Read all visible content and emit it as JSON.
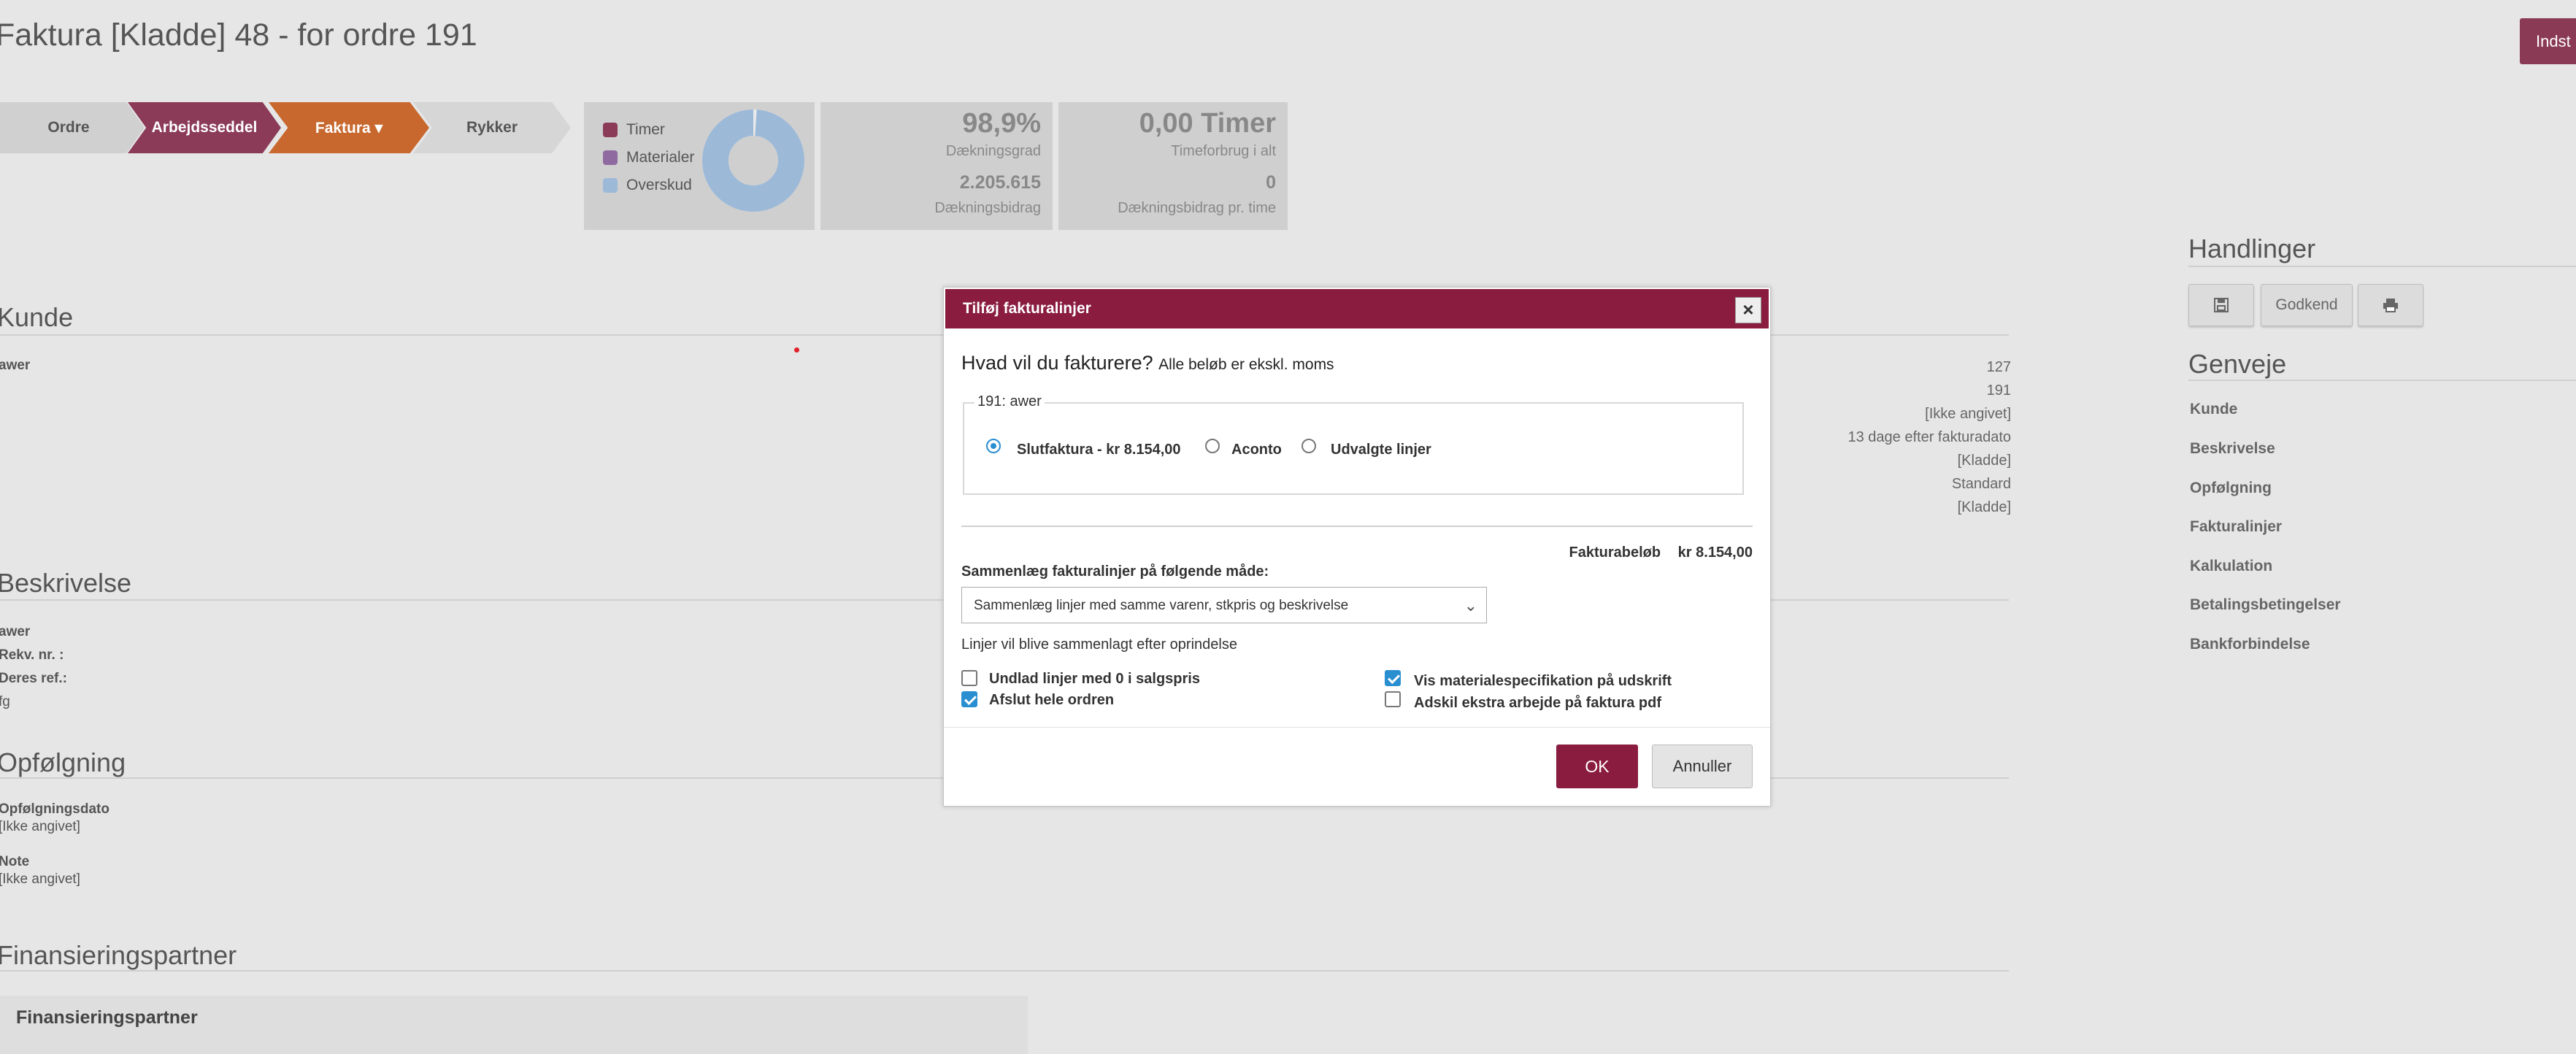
{
  "page": {
    "title": "Faktura [Kladde] 48 - for ordre 191",
    "settings_button": "Indst"
  },
  "workflow": {
    "steps": [
      "Ordre",
      "Arbejdsseddel",
      "Faktura ▾",
      "Rykker"
    ]
  },
  "legend": {
    "items": [
      {
        "label": "Timer",
        "color": "#8b3b58"
      },
      {
        "label": "Materialer",
        "color": "#8e6aa0"
      },
      {
        "label": "Overskud",
        "color": "#9cb9d8"
      }
    ]
  },
  "donut": {
    "overskud_fraction": 0.989
  },
  "kpi": {
    "coverage_pct": "98,9%",
    "coverage_label": "Dækningsgrad",
    "contribution": "2.205.615",
    "contribution_label": "Dækningsbidrag",
    "hours": "0,00 Timer",
    "hours_label": "Timeforbrug i alt",
    "per_hour": "0",
    "per_hour_label": "Dækningsbidrag pr. time"
  },
  "sections": {
    "kunde": {
      "title": "Kunde",
      "customer_name": "awer",
      "values": [
        "127",
        "191",
        "[Ikke angivet]",
        "13 dage efter fakturadato",
        "[Kladde]",
        "Standard",
        "[Kladde]"
      ]
    },
    "beskrivelse": {
      "title": "Beskrivelse",
      "lines": [
        "awer",
        "Rekv. nr. :",
        "Deres ref.:",
        "fg"
      ]
    },
    "opfolgning": {
      "title": "Opfølgning",
      "date_label": "Opfølgningsdato",
      "date_value": "[Ikke angivet]",
      "note_label": "Note",
      "note_value": "[Ikke angivet]"
    },
    "finansiering": {
      "title": "Finansieringspartner",
      "card_title": "Finansieringspartner"
    }
  },
  "sidebar": {
    "actions_title": "Handlinger",
    "approve_button": "Godkend",
    "shortcuts_title": "Genveje",
    "links": [
      "Kunde",
      "Beskrivelse",
      "Opfølgning",
      "Fakturalinjer",
      "Kalkulation",
      "Betalingsbetingelser",
      "Bankforbindelse"
    ]
  },
  "modal": {
    "title": "Tilføj fakturalinjer",
    "close": "×",
    "question": "Hvad vil du fakturere?",
    "question_note": "Alle beløb er ekskl. moms",
    "fieldset_legend": "191: awer",
    "radios": [
      {
        "label": "Slutfaktura - kr 8.154,00",
        "checked": true
      },
      {
        "label": "Aconto",
        "checked": false
      },
      {
        "label": "Udvalgte linjer",
        "checked": false
      }
    ],
    "amount_label": "Fakturabeløb",
    "amount_value": "kr 8.154,00",
    "merge_label": "Sammenlæg fakturalinjer på følgende måde:",
    "merge_selected": "Sammenlæg linjer med samme varenr, stkpris og beskrivelse",
    "merge_note": "Linjer vil blive sammenlagt efter oprindelse",
    "checkboxes": [
      {
        "label": "Undlad linjer med 0 i salgspris",
        "checked": false
      },
      {
        "label": "Afslut hele ordren",
        "checked": true
      },
      {
        "label": "Vis materialespecifikation på udskrift",
        "checked": true
      },
      {
        "label": "Adskil ekstra arbejde på faktura pdf",
        "checked": false
      }
    ],
    "ok": "OK",
    "cancel": "Annuller"
  }
}
